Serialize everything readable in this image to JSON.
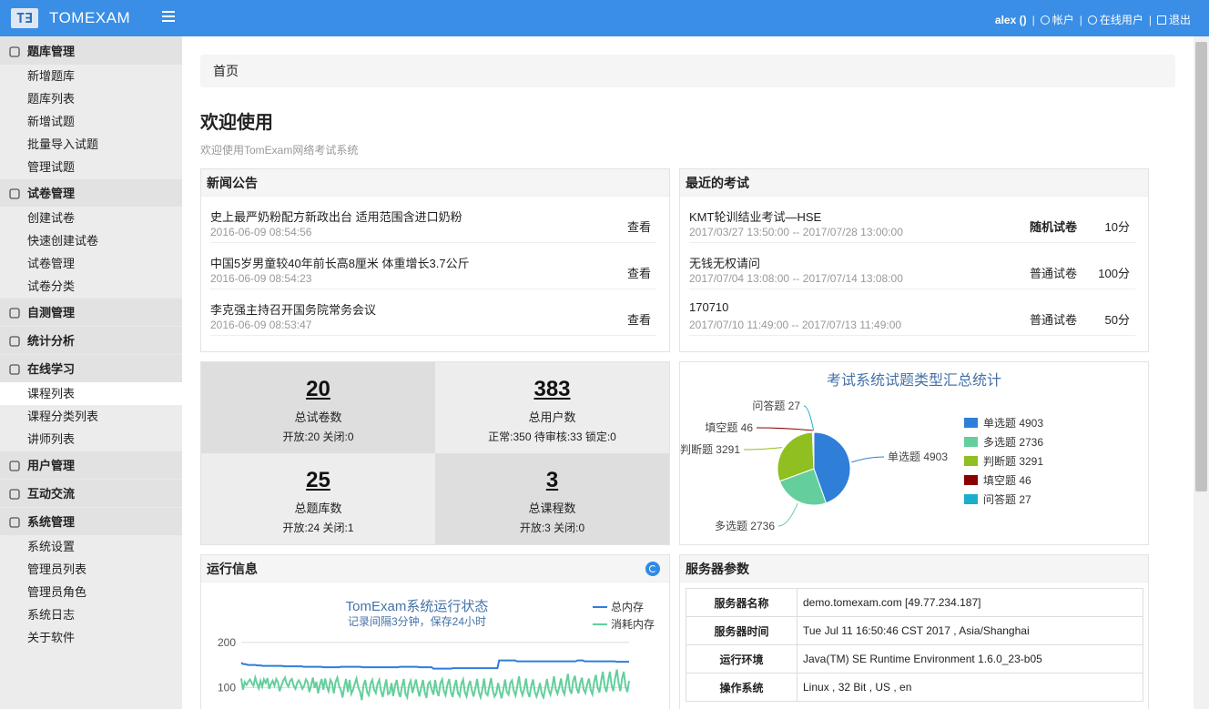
{
  "header": {
    "logo_text": "T∃",
    "brand": "TOMEXAM",
    "user": "alex ()",
    "separator": "|",
    "account": "帐户",
    "online_users": "在线用户",
    "logout": "退出"
  },
  "sidebar": {
    "groups": [
      {
        "label": "题库管理",
        "icon": "database-icon",
        "items": [
          "新增题库",
          "题库列表",
          "新增试题",
          "批量导入试题",
          "管理试题"
        ]
      },
      {
        "label": "试卷管理",
        "icon": "document-icon",
        "items": [
          "创建试卷",
          "快速创建试卷",
          "试卷管理",
          "试卷分类"
        ]
      },
      {
        "label": "自测管理",
        "icon": "document-icon",
        "items": []
      },
      {
        "label": "统计分析",
        "icon": "bar-chart-icon",
        "items": []
      },
      {
        "label": "在线学习",
        "icon": "presentation-icon",
        "items": [
          "课程列表",
          "课程分类列表",
          "讲师列表"
        ]
      },
      {
        "label": "用户管理",
        "icon": "users-icon",
        "items": []
      },
      {
        "label": "互动交流",
        "icon": "target-icon",
        "items": []
      },
      {
        "label": "系统管理",
        "icon": "monitor-icon",
        "items": [
          "系统设置",
          "管理员列表",
          "管理员角色",
          "系统日志",
          "关于软件"
        ]
      }
    ],
    "active_item": "课程列表"
  },
  "breadcrumb": "首页",
  "page": {
    "title": "欢迎使用",
    "subtitle": "欢迎使用TomExam网络考试系统"
  },
  "news": {
    "title": "新闻公告",
    "view_label": "查看",
    "items": [
      {
        "title": "史上最严奶粉配方新政出台 适用范围含进口奶粉",
        "time": "2016-06-09 08:54:56"
      },
      {
        "title": "中国5岁男童较40年前长高8厘米 体重增长3.7公斤",
        "time": "2016-06-09 08:54:23"
      },
      {
        "title": "李克强主持召开国务院常务会议",
        "time": "2016-06-09 08:53:47"
      }
    ]
  },
  "exams": {
    "title": "最近的考试",
    "items": [
      {
        "name": "KMT轮训结业考试—HSE",
        "time": "2017/03/27 13:50:00 -- 2017/07/28 13:00:00",
        "type": "随机试卷",
        "score": "10分",
        "bold": true
      },
      {
        "name": "无钱无权请问",
        "time": "2017/07/04 13:08:00 -- 2017/07/14 13:08:00",
        "type": "普通试卷",
        "score": "100分",
        "bold": false
      },
      {
        "name": "170710",
        "time": "2017/07/10 11:49:00 -- 2017/07/13 11:49:00",
        "type": "普通试卷",
        "score": "50分",
        "bold": false
      }
    ]
  },
  "stats": [
    {
      "num": "20",
      "label": "总试卷数",
      "detail": "开放:20 关闭:0"
    },
    {
      "num": "383",
      "label": "总用户数",
      "detail": "正常:350 待审核:33 锁定:0"
    },
    {
      "num": "25",
      "label": "总题库数",
      "detail": "开放:24 关闭:1"
    },
    {
      "num": "3",
      "label": "总课程数",
      "detail": "开放:3 关闭:0"
    }
  ],
  "chart_data": [
    {
      "type": "pie",
      "title": "考试系统试题类型汇总统计",
      "legend_position": "right",
      "slices": [
        {
          "name": "单选题",
          "value": 4903,
          "color": "#2f7ed8"
        },
        {
          "name": "多选题",
          "value": 2736,
          "color": "#64cf9c"
        },
        {
          "name": "判断题",
          "value": 3291,
          "color": "#8fbf20"
        },
        {
          "name": "填空题",
          "value": 46,
          "color": "#8b0000"
        },
        {
          "name": "问答题",
          "value": 27,
          "color": "#1aadce"
        }
      ]
    },
    {
      "type": "line",
      "title": "TomExam系统运行状态",
      "subtitle": "记录间隔3分钟，保存24小时",
      "legend_position": "top-right",
      "y_ticks": [
        "200",
        "100"
      ],
      "ylim": [
        0,
        250
      ],
      "grid": true,
      "series": [
        {
          "name": "总内存",
          "color": "#2f7ed8",
          "values": [
            155,
            152,
            152,
            151,
            150,
            150,
            150,
            150,
            150,
            149,
            149,
            149,
            148,
            148,
            148,
            148,
            148,
            148,
            148,
            148,
            148,
            148,
            148,
            148,
            147,
            147,
            147,
            147,
            147,
            147,
            147,
            147,
            147,
            147,
            147,
            146,
            146,
            146,
            146,
            146,
            146,
            146,
            146,
            146,
            146,
            146,
            145,
            145,
            145,
            145,
            145,
            145,
            145,
            145,
            145,
            145,
            146,
            146,
            146,
            146,
            146,
            146,
            146,
            146,
            146,
            146,
            146,
            146,
            145,
            145,
            145,
            145,
            145,
            145,
            145,
            145,
            145,
            145,
            145,
            145,
            145,
            145,
            145,
            145,
            145,
            145,
            145,
            145,
            145,
            146,
            146,
            146,
            146,
            146,
            146,
            146,
            146,
            146,
            146,
            146,
            145,
            145,
            145,
            145,
            145,
            145,
            145,
            145,
            142,
            142,
            142,
            142,
            142,
            142,
            142,
            142,
            142,
            142,
            142,
            143,
            143,
            143,
            143,
            143,
            143,
            143,
            143,
            143,
            143,
            143,
            143,
            143,
            143,
            143,
            143,
            143,
            143,
            143,
            143,
            143,
            143,
            143,
            143,
            143,
            143,
            160,
            160,
            160,
            160,
            160,
            160,
            160,
            160,
            160,
            160,
            158,
            158,
            158,
            158,
            158,
            158,
            158,
            158,
            158,
            158,
            158,
            158,
            158,
            158,
            158,
            158,
            158,
            158,
            158,
            158,
            158,
            158,
            158,
            158,
            158,
            158,
            158,
            158,
            158,
            158,
            158,
            158,
            158,
            158,
            160,
            160,
            160,
            160,
            158,
            158,
            158,
            158,
            158,
            158,
            158,
            158,
            158,
            158,
            158,
            158,
            158,
            158,
            158,
            158,
            158,
            158,
            157,
            157,
            157,
            157,
            157,
            157,
            157,
            157
          ]
        },
        {
          "name": "消耗内存",
          "color": "#64cf9c",
          "values": [
            120,
            95,
            112,
            106,
            113,
            118,
            110,
            104,
            122,
            109,
            98,
            115,
            102,
            118,
            110,
            121,
            97,
            108,
            115,
            104,
            119,
            112,
            92,
            104,
            115,
            122,
            108,
            102,
            115,
            119,
            104,
            97,
            110,
            116,
            108,
            97,
            104,
            118,
            112,
            90,
            105,
            122,
            99,
            113,
            87,
            106,
            119,
            95,
            120,
            102,
            92,
            117,
            110,
            87,
            112,
            122,
            103,
            95,
            78,
            102,
            119,
            90,
            117,
            86,
            95,
            108,
            120,
            100,
            91,
            72,
            105,
            117,
            90,
            83,
            108,
            117,
            96,
            88,
            108,
            117,
            92,
            79,
            100,
            118,
            85,
            88,
            110,
            81,
            104,
            117,
            90,
            79,
            102,
            119,
            86,
            78,
            105,
            115,
            88,
            103,
            118,
            96,
            80,
            99,
            117,
            90,
            77,
            108,
            113,
            95,
            84,
            117,
            93,
            81,
            110,
            118,
            92,
            83,
            106,
            119,
            90,
            79,
            102,
            117,
            88,
            81,
            108,
            118,
            90,
            80,
            103,
            115,
            94,
            80,
            98,
            119,
            90,
            78,
            95,
            120,
            88,
            83,
            103,
            121,
            94,
            80,
            88,
            110,
            92,
            76,
            95,
            118,
            90,
            84,
            110,
            116,
            92,
            82,
            103,
            125,
            95,
            83,
            98,
            120,
            90,
            79,
            103,
            118,
            91,
            80,
            93,
            110,
            86,
            78,
            98,
            119,
            95,
            84,
            101,
            125,
            97,
            86,
            100,
            120,
            94,
            85,
            110,
            130,
            96,
            86,
            115,
            126,
            99,
            87,
            110,
            122,
            96,
            88,
            106,
            120,
            95,
            85,
            112,
            128,
            100,
            89,
            115,
            135,
            104,
            90,
            115,
            135,
            105,
            92,
            120,
            140,
            110,
            92,
            120,
            135,
            102,
            90,
            115
          ]
        }
      ]
    }
  ],
  "run_info": {
    "title": "运行信息"
  },
  "server": {
    "title": "服务器参数",
    "rows": [
      {
        "k": "服务器名称",
        "v": "demo.tomexam.com [49.77.234.187]"
      },
      {
        "k": "服务器时间",
        "v": "Tue Jul 11 16:50:46 CST 2017 , Asia/Shanghai"
      },
      {
        "k": "运行环境",
        "v": "Java(TM) SE Runtime Environment 1.6.0_23-b05"
      },
      {
        "k": "操作系统",
        "v": "Linux , 32 Bit , US , en"
      }
    ]
  }
}
